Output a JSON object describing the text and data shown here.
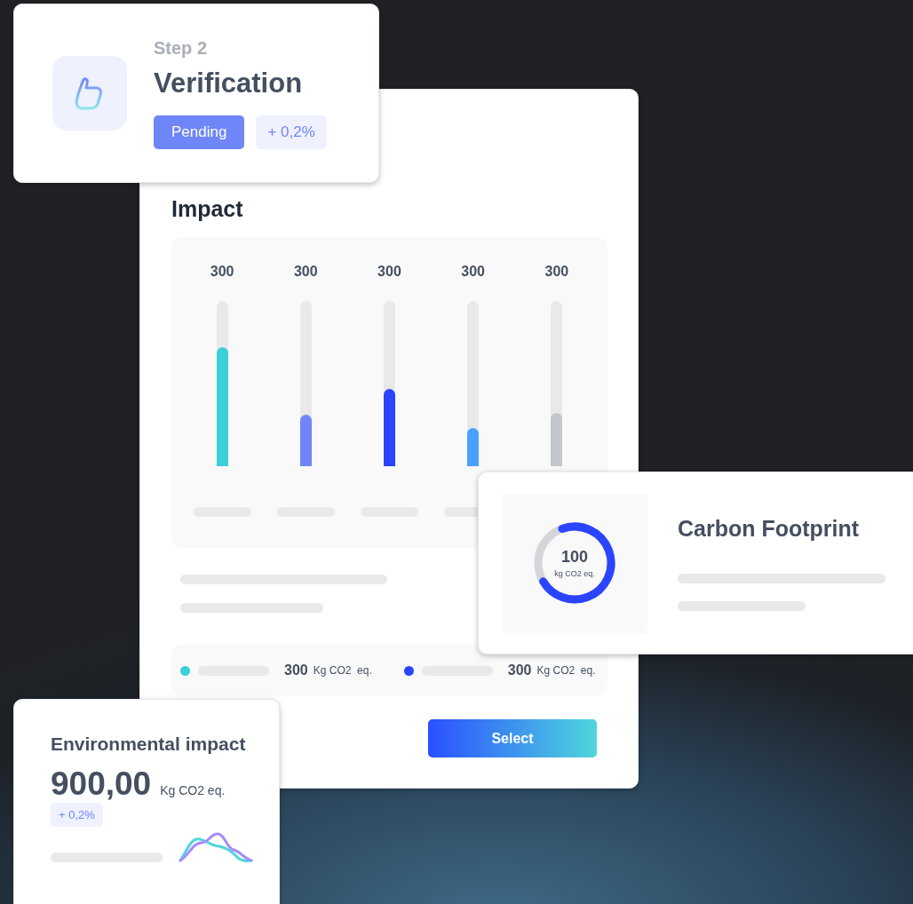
{
  "verification_card": {
    "step": "Step 2",
    "title": "Verification",
    "status": "Pending",
    "change": "+ 0,2%"
  },
  "impact_card": {
    "title": "Impact",
    "bars": [
      {
        "value": "300",
        "level": 0.72,
        "color": "#3ad0da"
      },
      {
        "value": "300",
        "level": 0.31,
        "color": "#6f86f8"
      },
      {
        "value": "300",
        "level": 0.47,
        "color": "#2b44ff"
      },
      {
        "value": "300",
        "level": 0.23,
        "color": "#4aa0ff"
      },
      {
        "value": "300",
        "level": 0.32,
        "color": "#c3c6cc"
      }
    ],
    "legend": [
      {
        "value": "300",
        "unit": "Kg CO2  eq.",
        "color": "#3ad0da"
      },
      {
        "value": "300",
        "unit": "Kg CO2  eq.",
        "color": "#2b44ff"
      }
    ],
    "button": "Select"
  },
  "carbon_card": {
    "title": "Carbon Footprint",
    "value": "100",
    "unit": "kg CO2 eq.",
    "level": 0.72
  },
  "environment_card": {
    "title": "Environmental impact",
    "value": "900,00",
    "unit": "Kg CO2 eq.",
    "change": "+ 0,2%"
  }
}
